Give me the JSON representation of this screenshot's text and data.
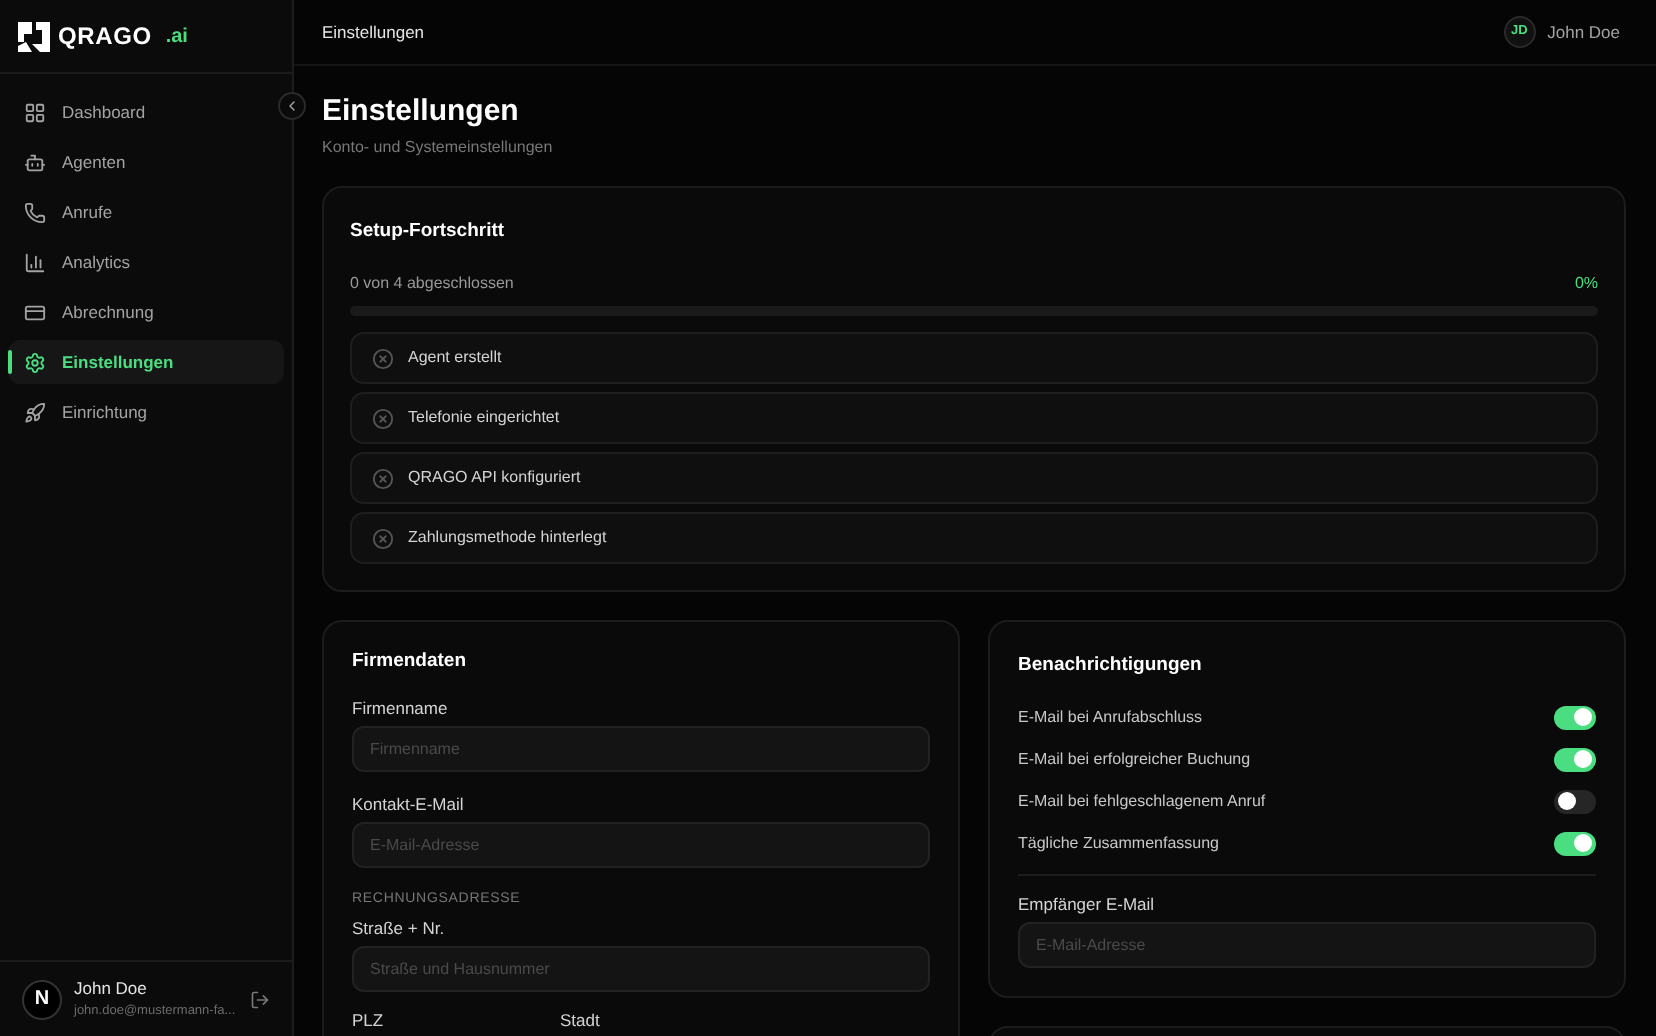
{
  "brand": {
    "name": "QRAGO",
    "suffix": ".ai"
  },
  "sidebar": {
    "items": [
      {
        "label": "Dashboard",
        "selected": false
      },
      {
        "label": "Agenten",
        "selected": false
      },
      {
        "label": "Anrufe",
        "selected": false
      },
      {
        "label": "Analytics",
        "selected": false
      },
      {
        "label": "Abrechnung",
        "selected": false
      },
      {
        "label": "Einstellungen",
        "selected": true
      },
      {
        "label": "Einrichtung",
        "selected": false
      }
    ],
    "user": {
      "avatar": "N",
      "name": "John Doe",
      "email": "john.doe@mustermann-fa..."
    }
  },
  "header": {
    "title": "Einstellungen",
    "user": {
      "initials": "JD",
      "name": "John Doe"
    }
  },
  "page": {
    "title": "Einstellungen",
    "subtitle": "Konto- und Systemeinstellungen"
  },
  "setup": {
    "title": "Setup-Fortschritt",
    "summary": "0 von 4 abgeschlossen",
    "percent": "0%",
    "level": 0,
    "steps": [
      {
        "label": "Agent erstellt",
        "done": false
      },
      {
        "label": "Telefonie eingerichtet",
        "done": false
      },
      {
        "label": "QRAGO API konfiguriert",
        "done": false
      },
      {
        "label": "Zahlungsmethode hinterlegt",
        "done": false
      }
    ]
  },
  "company": {
    "title": "Firmendaten",
    "fields": [
      {
        "label": "Firmenname",
        "placeholder": "Firmenname"
      },
      {
        "label": "Kontakt-E-Mail",
        "placeholder": "E-Mail-Adresse"
      }
    ],
    "address_heading": "RECHNUNGSADRESSE",
    "street": {
      "label": "Straße + Nr.",
      "placeholder": "Straße und Hausnummer"
    },
    "postal_label": "PLZ",
    "city_label": "Stadt"
  },
  "notifications": {
    "title": "Benachrichtigungen",
    "toggles": [
      {
        "label": "E-Mail bei Anrufabschluss",
        "on": true
      },
      {
        "label": "E-Mail bei erfolgreicher Buchung",
        "on": true
      },
      {
        "label": "E-Mail bei fehlgeschlagenem Anruf",
        "on": false
      },
      {
        "label": "Tägliche Zusammenfassung",
        "on": true
      }
    ],
    "recipient": {
      "label": "Empfänger E-Mail",
      "placeholder": "E-Mail-Adresse"
    }
  }
}
